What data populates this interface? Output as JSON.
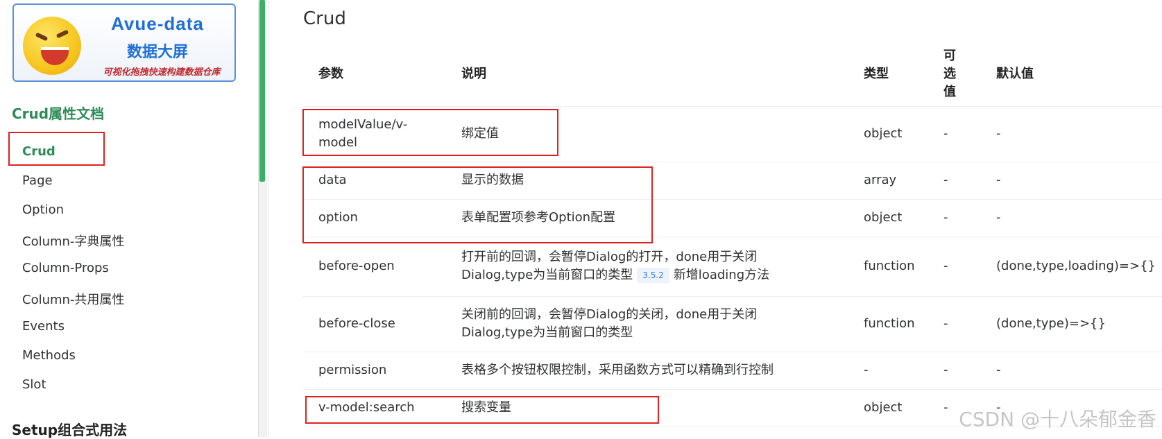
{
  "sidebar": {
    "logo": {
      "title": "Avue-data",
      "subtitle": "数据大屏",
      "tagline": "可视化拖拽快速构建数据仓库"
    },
    "section1": "Crud属性文档",
    "items": [
      {
        "label": "Crud",
        "active": true
      },
      {
        "label": "Page"
      },
      {
        "label": "Option"
      },
      {
        "label": "Column-字典属性"
      },
      {
        "label": "Column-Props"
      },
      {
        "label": "Column-共用属性"
      },
      {
        "label": "Events"
      },
      {
        "label": "Methods"
      },
      {
        "label": "Slot"
      }
    ],
    "section2": "Setup组合式用法"
  },
  "main": {
    "title": "Crud",
    "headers": [
      "参数",
      "说明",
      "类型",
      "可选值",
      "默认值"
    ],
    "rows": [
      {
        "param": "modelValue/v-model",
        "desc": "绑定值",
        "type": "object",
        "options": "-",
        "default": "-"
      },
      {
        "param": "data",
        "desc": "显示的数据",
        "type": "array",
        "options": "-",
        "default": "-"
      },
      {
        "param": "option",
        "desc": "表单配置项参考Option配置",
        "type": "object",
        "options": "-",
        "default": "-"
      },
      {
        "param": "before-open",
        "desc_a": "打开前的回调，会暂停Dialog的打开，done用于关闭",
        "desc_b": "Dialog,type为当前窗口的类型",
        "version": "3.5.2",
        "desc_c": "新增loading方法",
        "type": "function",
        "options": "-",
        "default": "(done,type,loading)=>{}"
      },
      {
        "param": "before-close",
        "desc_a": "关闭前的回调，会暂停Dialog的关闭，done用于关闭",
        "desc_b": "Dialog,type为当前窗口的类型",
        "type": "function",
        "options": "-",
        "default": "(done,type)=>{}"
      },
      {
        "param": "permission",
        "desc": "表格多个按钮权限控制，采用函数方式可以精确到行控制",
        "type": "-",
        "options": "-",
        "default": "-"
      },
      {
        "param": "v-model:search",
        "desc": "搜索变量",
        "type": "object",
        "options": "-",
        "default": "-"
      }
    ]
  },
  "watermark": "CSDN @十八朵郁金香",
  "colors": {
    "accent": "#2e8b57",
    "highlight": "#e02020",
    "version_tag": "#3a7bd5"
  }
}
